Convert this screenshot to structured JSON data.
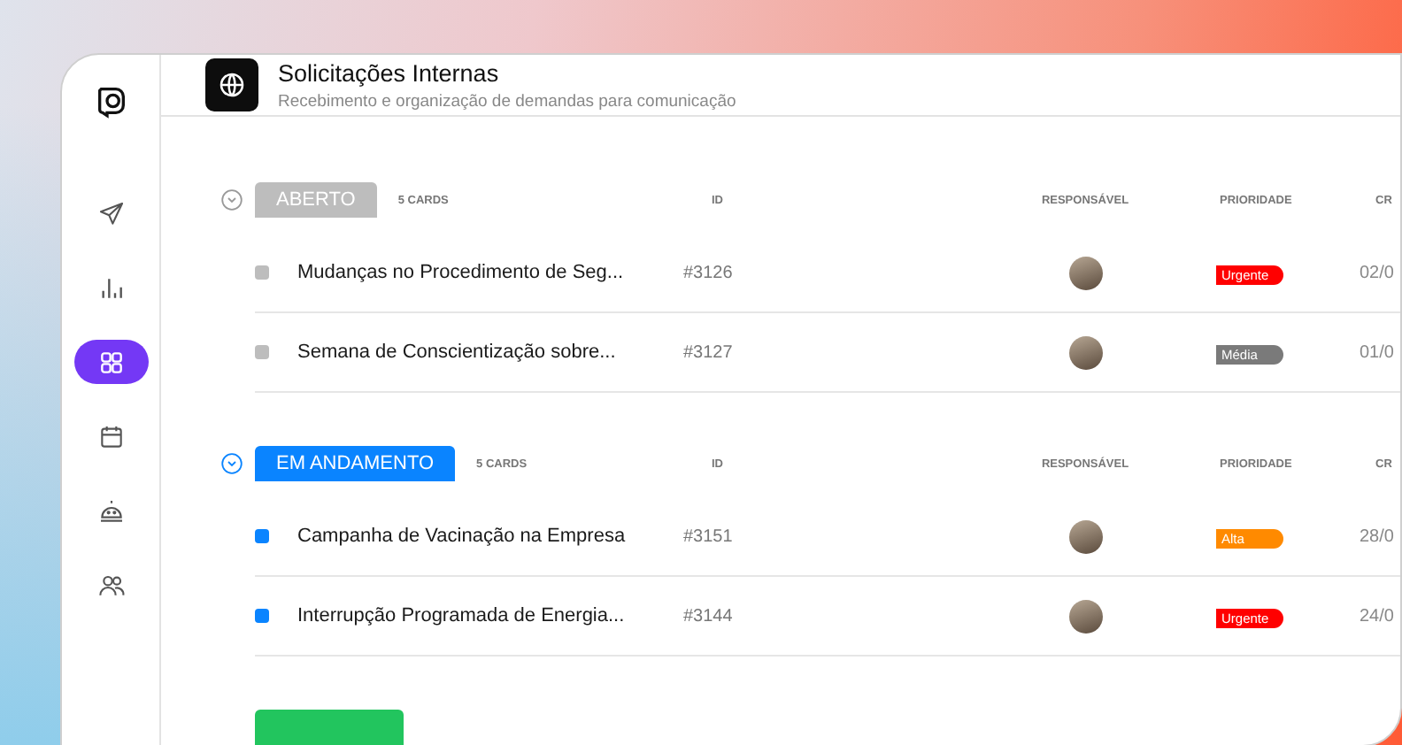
{
  "sidebar": {
    "items": [
      {
        "selected": false
      },
      {
        "selected": false
      },
      {
        "selected": true
      },
      {
        "selected": false
      },
      {
        "selected": false
      },
      {
        "selected": false
      }
    ]
  },
  "header": {
    "title": "Solicitações Internas",
    "subtitle": "Recebimento e organização de demandas para comunicação"
  },
  "groups": [
    {
      "label": "ABERTO",
      "color": "#bdbdbd",
      "count": "5 CARDS",
      "expanded": true,
      "columns": {
        "id": "ID",
        "assignee": "RESPONSÁVEL",
        "priority": "PRIORIDADE",
        "column_5": "CR"
      },
      "rows": [
        {
          "title": "Mudanças no Procedimento de Seg...",
          "id": "#3126",
          "priority": "Urgente",
          "color": "#ff0000",
          "date": "02/0"
        },
        {
          "title": "Semana de Conscientização sobre...",
          "id": "#3127",
          "priority": "Média",
          "color": "#7a7a7a",
          "date": "01/0"
        }
      ]
    },
    {
      "label": "EM ANDAMENTO",
      "color": "#0a84ff",
      "count": "5 CARDS",
      "expanded": true,
      "columns": {
        "id": "ID",
        "assignee": "RESPONSÁVEL",
        "priority": "PRIORIDADE",
        "column_5": "CR"
      },
      "rows": [
        {
          "title": "Campanha de Vacinação na Empresa",
          "id": "#3151",
          "priority": "Alta",
          "color": "#ff8a00",
          "date": "28/0"
        },
        {
          "title": "Interrupção Programada de Energia...",
          "id": "#3144",
          "priority": "Urgente",
          "color": "#ff0000",
          "date": "24/0"
        }
      ]
    }
  ],
  "next_group": {
    "color": "#22c55e"
  }
}
